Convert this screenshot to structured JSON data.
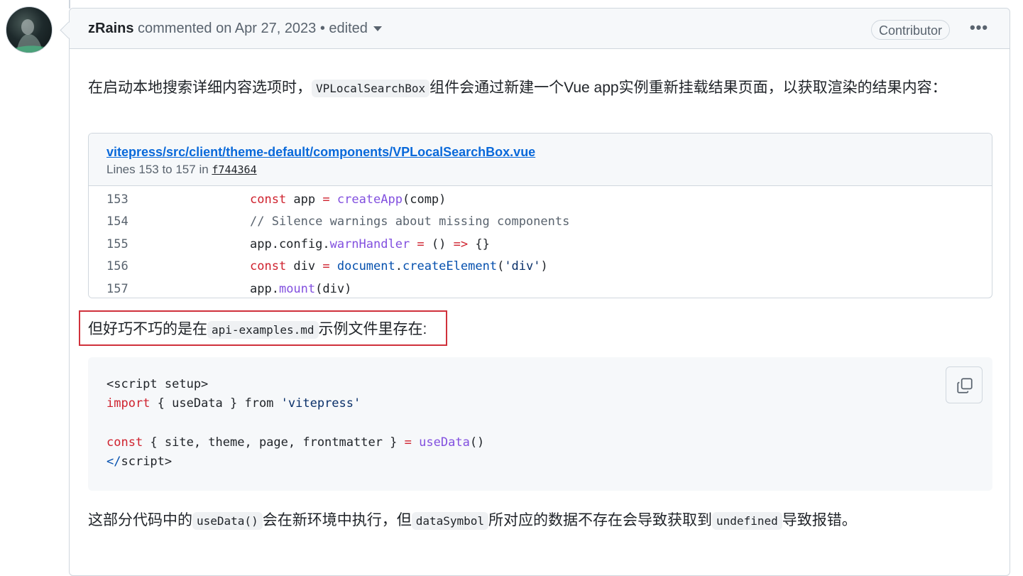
{
  "comment": {
    "author": "zRains",
    "meta": " commented on Apr 27, 2023 • edited",
    "badge": "Contributor",
    "menu_icon": "kebab-horizontal-icon"
  },
  "para1": {
    "text_before": "在启动本地搜索详细内容选项时，",
    "code": "VPLocalSearchBox",
    "text_after": "组件会通过新建一个Vue app实例重新挂载结果页面，以获取渲染的结果内容："
  },
  "permalink": {
    "path": "vitepress/src/client/theme-default/components/VPLocalSearchBox.vue",
    "lines_label": "Lines 153 to 157 in ",
    "sha": "f744364",
    "rows": [
      {
        "ln": "153"
      },
      {
        "ln": "154"
      },
      {
        "ln": "155"
      },
      {
        "ln": "156"
      },
      {
        "ln": "157"
      }
    ],
    "tokens": {
      "const": "const",
      "app": " app ",
      "eq": "=",
      "createApp": " createApp",
      "comp": "(comp)",
      "comment": "// Silence warnings about missing components",
      "app_config": "app.config.",
      "warnHandler": "warnHandler",
      "arrow_eq": " = ",
      "parens": "() ",
      "arrow": "=>",
      "braces": " {}",
      "div": " div ",
      "document": " document",
      "dot": ".",
      "createElement": "createElement",
      "div_arg_open": "(",
      "div_str": "'div'",
      "div_arg_close": ")",
      "app_dot": "app.",
      "mount": "mount",
      "mount_arg": "(div)"
    }
  },
  "para2": {
    "text_before": "但好巧不巧的是在",
    "code": "api-examples.md",
    "text_after": "示例文件里存在",
    "colon": ":"
  },
  "code_block": {
    "line1": "<script setup>",
    "import": "import",
    "line2_rest": " { useData } from ",
    "vitepress": "'vitepress'",
    "const": "const",
    "line4_mid": " { site, theme, page, frontmatter } ",
    "eq": "=",
    "useData": "useData",
    "call": "()",
    "close_open": "</",
    "close_rest": "script>",
    "copy_icon": "copy-icon"
  },
  "para3": {
    "t1": "这部分代码中的",
    "c1": "useData()",
    "t2": "会在新环境中执行，但",
    "c2": "dataSymbol",
    "t3": "所对应的数据不存在会导致获取到",
    "c3": "undefined",
    "t4": "导致报错。"
  }
}
